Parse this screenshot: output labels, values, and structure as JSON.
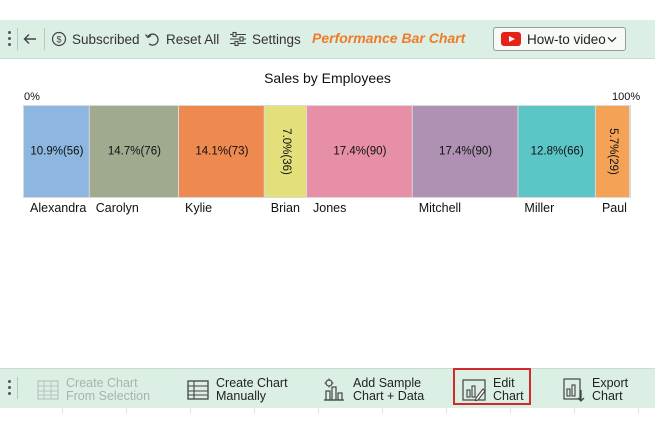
{
  "toolbar": {
    "back_icon": "back-arrow-icon",
    "subscribed": "Subscribed",
    "reset_all": "Reset All",
    "settings": "Settings",
    "title": "Performance Bar Chart",
    "video": "How-to video"
  },
  "chart_data": {
    "type": "bar",
    "orientation": "stacked-horizontal-100-percent",
    "title": "Sales by Employees",
    "scale_min_label": "0%",
    "scale_max_label": "100%",
    "categories": [
      "Alexandra",
      "Carolyn",
      "Kylie",
      "Brian",
      "Jones",
      "Mitchell",
      "Miller",
      "Paul"
    ],
    "values": [
      56,
      76,
      73,
      36,
      90,
      90,
      66,
      29
    ],
    "labels": [
      "10.9%(56)",
      "14.7%(76)",
      "14.1%(73)",
      "7.0%(36)",
      "17.4%(90)",
      "17.4%(90)",
      "12.8%(66)",
      "5.7%(29)"
    ],
    "label_rotated": [
      false,
      false,
      false,
      true,
      false,
      false,
      false,
      true
    ],
    "colors": [
      "#8db6e0",
      "#9faa8e",
      "#ee8a50",
      "#e3e07c",
      "#e88fa8",
      "#ae91b3",
      "#5cc5c6",
      "#f4a356"
    ]
  },
  "ribbon": {
    "create_from_selection": [
      "Create Chart",
      "From Selection"
    ],
    "create_manually": [
      "Create Chart",
      "Manually"
    ],
    "add_sample": [
      "Add Sample",
      "Chart + Data"
    ],
    "edit_chart": [
      "Edit",
      "Chart"
    ],
    "export_chart": [
      "Export",
      "Chart"
    ]
  }
}
